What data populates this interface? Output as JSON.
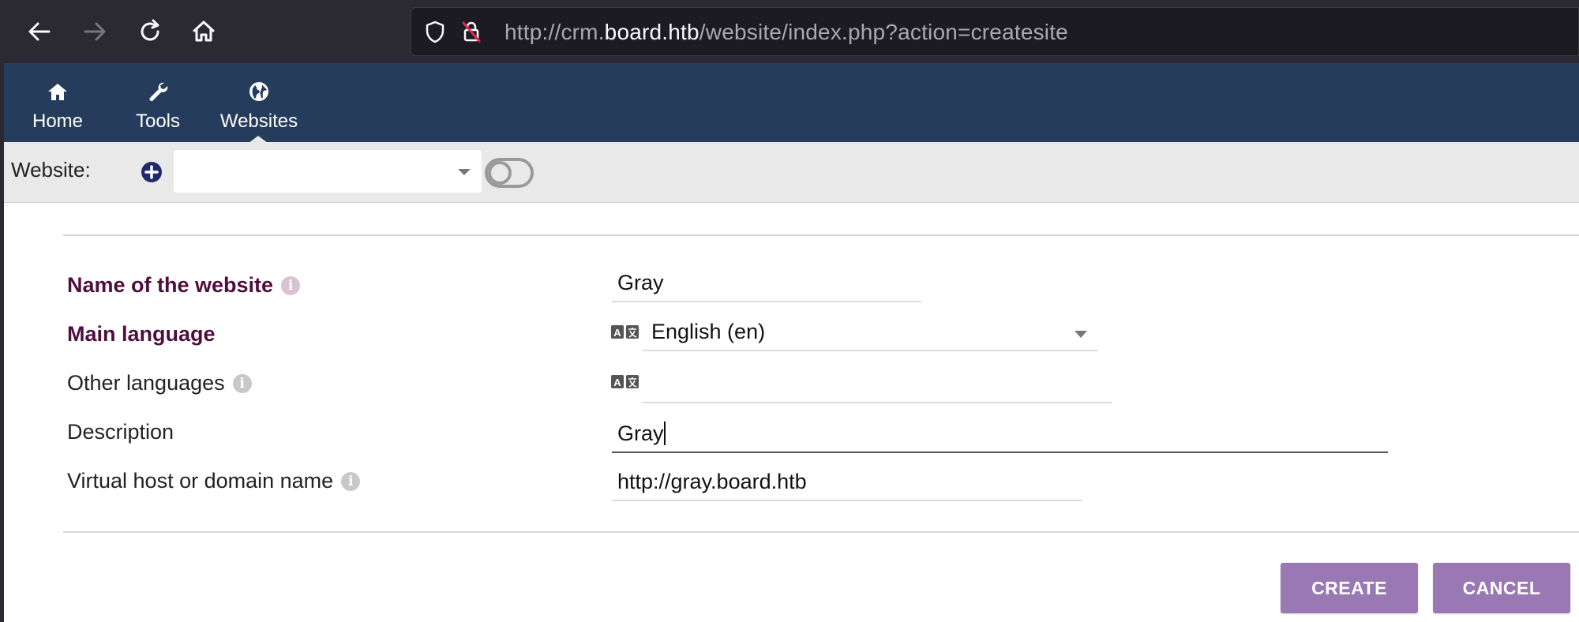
{
  "browser": {
    "url_prefix": "http://crm.",
    "url_domain": "board.htb",
    "url_path": "/website/index.php?action=createsite"
  },
  "menu": {
    "items": [
      {
        "label": "Home",
        "icon": "home-icon"
      },
      {
        "label": "Tools",
        "icon": "wrench-icon"
      },
      {
        "label": "Websites",
        "icon": "globe-icon"
      }
    ]
  },
  "website_bar": {
    "label": "Website:",
    "selected": ""
  },
  "form": {
    "name_label": "Name of the website",
    "name_value": "Gray",
    "main_language_label": "Main language",
    "main_language_value": "English (en)",
    "other_languages_label": "Other languages",
    "other_languages_value": "",
    "description_label": "Description",
    "description_value": "Gray",
    "vhost_label": "Virtual host or domain name",
    "vhost_value": "http://gray.board.htb"
  },
  "buttons": {
    "create": "CREATE",
    "cancel": "CANCEL"
  },
  "colors": {
    "menu_bg": "#263c5c",
    "required_label": "#4f0e3f",
    "button": "#9a78b3"
  }
}
